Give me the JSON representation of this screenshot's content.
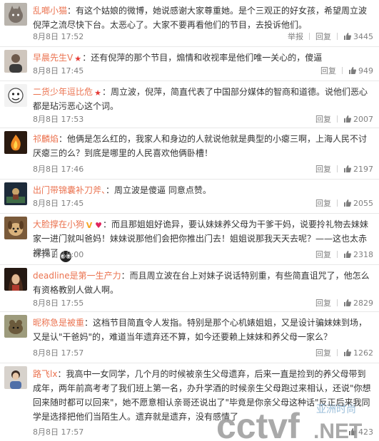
{
  "labels": {
    "reply": "回复",
    "report": "举报"
  },
  "colors": {
    "username": "#eb7350",
    "meta": "#808080",
    "accent_red": "#e53935"
  },
  "comments": [
    {
      "username": "乱啷小猫",
      "badge": "",
      "sep": "：",
      "text": "有这个姑娘的微博，她说感谢大家尊重她。是个三观正的好女孩，希望周立波倪萍之流尽快下台。太恶心了。大家不要再看他们的节目，去投诉他们。",
      "time": "8月8日 17:52",
      "likes": "3445",
      "show_report": true,
      "avatar": "cat-avatar"
    },
    {
      "username": "早晨先生V",
      "badge": "star",
      "sep": "：",
      "text": "还有倪萍的那个节目，煽情和收视率是他们唯一关心的，傻逼",
      "time": "8月8日 17:45",
      "likes": "949",
      "show_report": false,
      "avatar": "man-avatar"
    },
    {
      "username": "二货少年逗比危",
      "badge": "star",
      "sep": "：",
      "text": "周立波，倪萍，简直代表了中国部分媒体的智商和道德。说他们恶心都是玷污恶心这个词。",
      "time": "8月8日 17:53",
      "likes": "2007",
      "show_report": false,
      "avatar": "cartoon-avatar"
    },
    {
      "username": "祁麟焰",
      "badge": "",
      "sep": "：",
      "text": "他俩是怎么红的，我家人和身边的人就说他就是典型的小瘪三啊，上海人民不讨厌瘪三的么？到底是哪里的人民喜欢他俩卧槽！",
      "time": "8月8日 17:46",
      "likes": "2197",
      "show_report": false,
      "avatar": "flame-avatar"
    },
    {
      "username": "出门带锦囊补刀斧、",
      "badge": "",
      "sep": "：",
      "text": "周立波是傻逼 同意点赞。",
      "time": "8月8日 17:45",
      "likes": "2055",
      "show_report": false,
      "avatar": "game-avatar"
    },
    {
      "username": "大脸撑在小狗",
      "badge": "v-heart",
      "sep": "：",
      "text": "而且那姐姐好诡异，要认妹妹养父母为干爹干妈，说要拎礼物去妹妹家一进门就叫爸妈！妹妹说那他们会把你推出门去！姐姐说那我天天去呢？——这也太赤裸裸了",
      "time": "8月8日 18:00",
      "likes": "2318",
      "show_report": false,
      "avatar": "dog-avatar",
      "extra_icon": true
    },
    {
      "username": "deadline是第一生产力",
      "badge": "",
      "sep": "：",
      "text": "而且周立波在台上对妹子说话特别重，有些简直诅咒了，他怎么有资格教别人做人啊。",
      "time": "8月8日 17:55",
      "likes": "2829",
      "show_report": false,
      "avatar": "woman-avatar"
    },
    {
      "username": "昵称急是被重",
      "badge": "",
      "sep": "：",
      "text": "这档节目简直令人发指。特别是那个心机婊姐姐，又是设计骗妹妹到场，又是认\"干爸妈\"的，难道当年遗弃还不算，如今还要赖上妹妹和养父母一家么？",
      "time": "8月8日 17:57",
      "likes": "1262",
      "show_report": false,
      "avatar": "animal-avatar"
    },
    {
      "username": "路飞lx",
      "badge": "",
      "sep": "：",
      "text": "我高中一女同学，几个月的时候被亲生父母遗弃，后来一直是捡到的养父母带到成年，两年前高考考了我们班上第一名，办升学酒的时候亲生父母跑过来相认，还说\"你想回来随时都可以回来\"，她不愿意相认亲哥还说出了\"毕竟是你亲父母这种话\"反正后来我同学是选择把他们当陌生人。遗弃就是遗弃，没有感情了",
      "time": "8月8日 17:57",
      "likes": "423",
      "show_report": false,
      "avatar": "boy-avatar"
    }
  ],
  "watermark": {
    "logo": "cctvf.net",
    "tagline": "亚洲时尚"
  }
}
